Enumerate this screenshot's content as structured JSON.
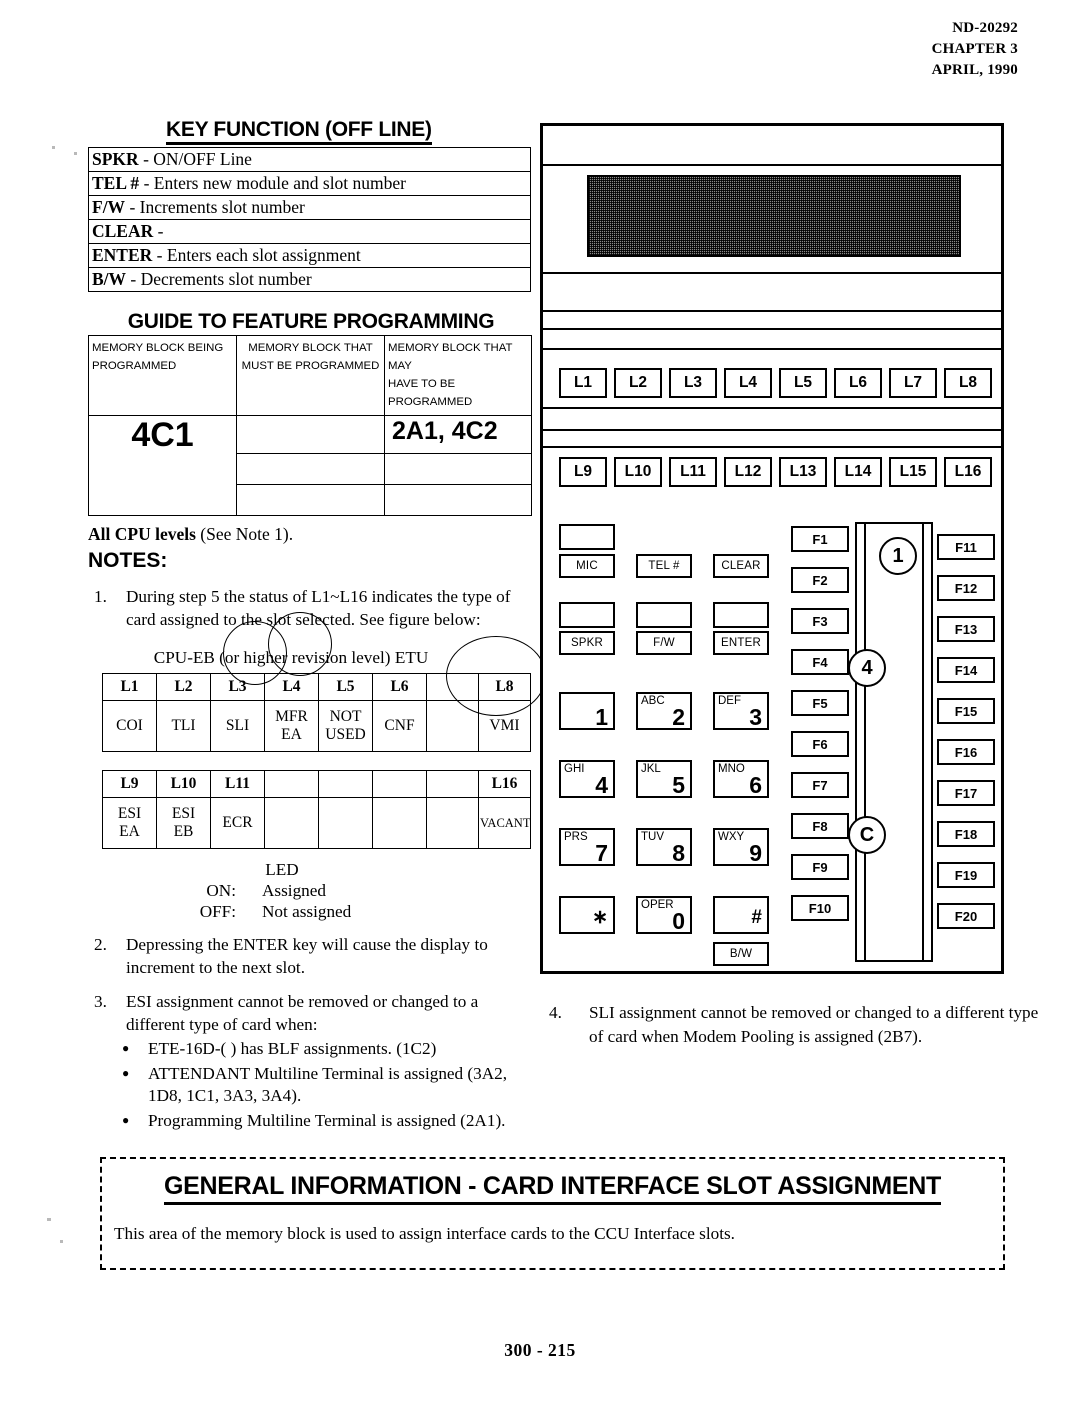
{
  "doc": {
    "number": "ND-20292",
    "chapter": "CHAPTER 3",
    "date": "APRIL, 1990",
    "page_footer": "300 - 215"
  },
  "key_function": {
    "title": "KEY FUNCTION (OFF LINE)",
    "rows": [
      {
        "key": "SPKR",
        "dash": "-",
        "desc": "ON/OFF Line"
      },
      {
        "key": "TEL #",
        "dash": "-",
        "desc": "Enters new module and slot number"
      },
      {
        "key": "F/W",
        "dash": "-",
        "desc": "Increments slot number"
      },
      {
        "key": "CLEAR",
        "dash": "-",
        "desc": ""
      },
      {
        "key": "ENTER",
        "dash": "-",
        "desc": "Enters each slot assignment"
      },
      {
        "key": "B/W",
        "dash": "-",
        "desc": "Decrements slot number"
      }
    ]
  },
  "guide": {
    "title": "GUIDE TO FEATURE PROGRAMMING",
    "headers": [
      {
        "line1": "MEMORY BLOCK BEING",
        "line2": "PROGRAMMED"
      },
      {
        "line1": "MEMORY BLOCK THAT",
        "line2": "MUST BE PROGRAMMED"
      },
      {
        "line1": "MEMORY BLOCK THAT MAY",
        "line2": "HAVE TO BE PROGRAMMED"
      }
    ],
    "block_being_programmed": "4C1",
    "must_be_programmed": [
      "",
      "",
      ""
    ],
    "may_have_to_be_programmed": [
      "2A1, 4C2",
      "",
      ""
    ]
  },
  "cpu_levels": {
    "bold": "All CPU levels",
    "rest": "(See Note 1)."
  },
  "notes_heading": "NOTES:",
  "notes": [
    {
      "num": "1.",
      "text": "During step 5 the  status of L1~L16 indicates the type of card assigned to the slot selected.  See figure below:"
    },
    {
      "num": "2.",
      "text": "Depressing the ENTER key will cause the display to increment to the next slot."
    },
    {
      "num": "3.",
      "text": "ESI assignment cannot be removed or changed to a different type of card when:"
    },
    {
      "num": "4.",
      "text": "SLI assignment cannot be removed or changed to a different type of card when Modem Pooling is assigned (2B7)."
    }
  ],
  "note3_bullets": [
    "ETE-16D-(  ) has BLF assignments. (1C2)",
    "ATTENDANT Multiline Terminal is assigned (3A2, 1D8, 1C1, 3A3, 3A4).",
    "Programming Multiline Terminal is assigned (2A1)."
  ],
  "slot_figure": {
    "caption": "CPU-EB (or higher revision level) ETU",
    "table_top": {
      "labels": [
        "L1",
        "L2",
        "L3",
        "L4",
        "L5",
        "L6",
        "",
        "L8"
      ],
      "values": [
        "COI",
        "TLI",
        "SLI",
        "MFR\nEA",
        "NOT\nUSED",
        "CNF",
        "",
        "VMI"
      ]
    },
    "table_bottom": {
      "labels": [
        "L9",
        "L10",
        "L11",
        "",
        "",
        "",
        "",
        "L16"
      ],
      "values": [
        "ESI\nEA",
        "ESI\nEB",
        "ECR",
        "",
        "",
        "",
        "",
        "VACANT"
      ]
    }
  },
  "led_legend": {
    "title": "LED",
    "rows": [
      {
        "label": "ON:",
        "value": "Assigned"
      },
      {
        "label": "OFF:",
        "value": "Not assigned"
      }
    ]
  },
  "phone": {
    "line_keys_row1": [
      "L1",
      "L2",
      "L3",
      "L4",
      "L5",
      "L6",
      "L7",
      "L8"
    ],
    "line_keys_row2": [
      "L9",
      "L10",
      "L11",
      "L12",
      "L13",
      "L14",
      "L15",
      "L16"
    ],
    "function_keys": [
      "MIC",
      "TEL #",
      "CLEAR",
      "SPKR",
      "F/W",
      "ENTER"
    ],
    "bw_key": "B/W",
    "dial_keys": [
      {
        "letters": "",
        "digit": "1"
      },
      {
        "letters": "ABC",
        "digit": "2"
      },
      {
        "letters": "DEF",
        "digit": "3"
      },
      {
        "letters": "GHI",
        "digit": "4"
      },
      {
        "letters": "JKL",
        "digit": "5"
      },
      {
        "letters": "MNO",
        "digit": "6"
      },
      {
        "letters": "PRS",
        "digit": "7"
      },
      {
        "letters": "TUV",
        "digit": "8"
      },
      {
        "letters": "WXY",
        "digit": "9"
      },
      {
        "letters": "",
        "digit": "∗"
      },
      {
        "letters": "OPER",
        "digit": "0"
      },
      {
        "letters": "",
        "digit": "#"
      }
    ],
    "f_keys_left": [
      "F1",
      "F2",
      "F3",
      "F4",
      "F5",
      "F6",
      "F7",
      "F8",
      "F9",
      "F10"
    ],
    "f_keys_right": [
      "F11",
      "F12",
      "F13",
      "F14",
      "F15",
      "F16",
      "F17",
      "F18",
      "F19",
      "F20"
    ],
    "circle_marks": [
      "1",
      "4",
      "C"
    ]
  },
  "banner": {
    "title": "GENERAL INFORMATION  -  CARD INTERFACE SLOT ASSIGNMENT",
    "body": "This area of the memory block is used to assign interface cards to the CCU Interface slots."
  }
}
